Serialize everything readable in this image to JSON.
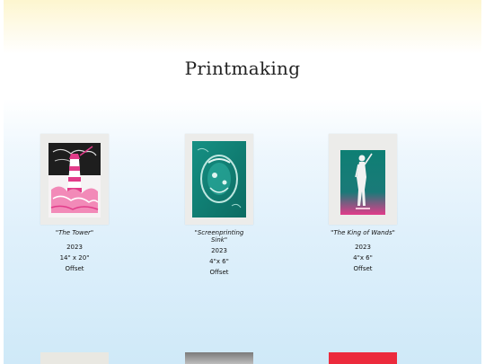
{
  "page": {
    "title": "Printmaking"
  },
  "artworks": [
    {
      "title": "\"The Tower\"",
      "year": "2023",
      "size": "14\" x 20\"",
      "medium": "Offset"
    },
    {
      "title": "\"Screenprinting Sink\"",
      "year": "2023",
      "size": "4\"x 6\"",
      "medium": "Offset"
    },
    {
      "title": "\"The King of Wands\"",
      "year": "2023",
      "size": "4\"x 6\"",
      "medium": "Offset"
    }
  ],
  "colors": {
    "pink": "#e23c8a",
    "teal": "#0e7f74",
    "black": "#1a1a1a",
    "paper": "#ececea"
  }
}
